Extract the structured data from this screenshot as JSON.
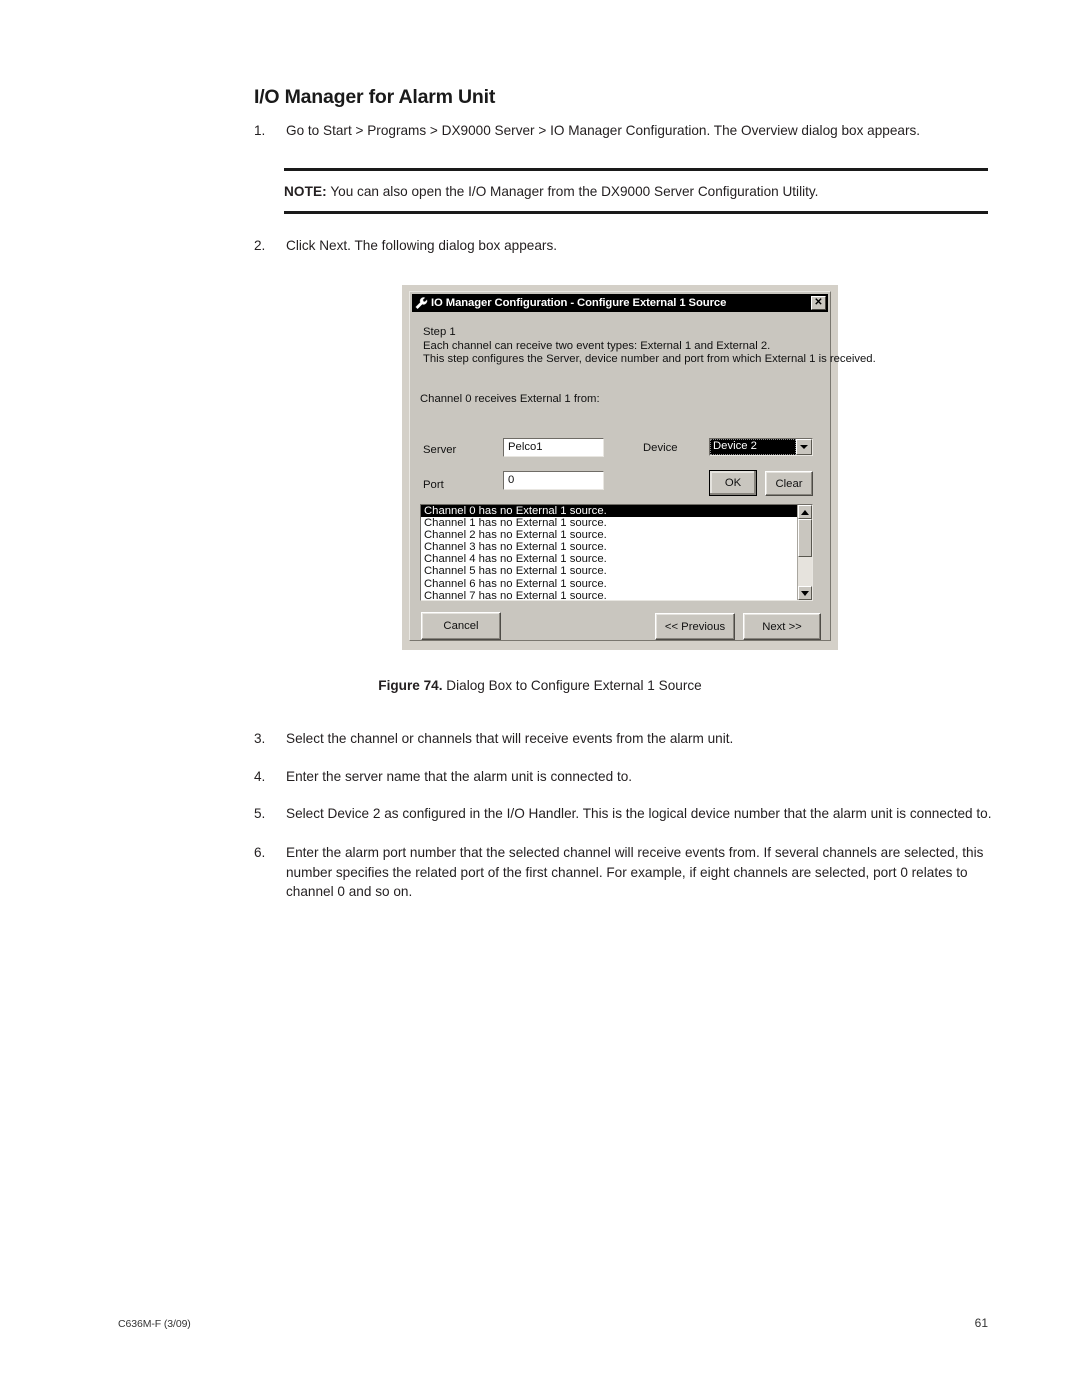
{
  "document": {
    "heading": "I/O Manager for Alarm Unit",
    "steps": [
      {
        "num": "1.",
        "text": "Go to Start > Programs > DX9000 Server > IO Manager Configuration. The Overview dialog box appears."
      },
      {
        "num": "2.",
        "text": "Click Next. The following dialog box appears."
      },
      {
        "num": "3.",
        "text": "Select the channel or channels that will receive events from the alarm unit."
      },
      {
        "num": "4.",
        "text": "Enter the server name that the alarm unit is connected to."
      },
      {
        "num": "5.",
        "text": "Select Device 2 as configured in the I/O Handler. This is the logical device number that the alarm unit is connected to."
      },
      {
        "num": "6.",
        "text": "Enter the alarm port number that the selected channel will receive events from. If several channels are selected, this number specifies the related port of the first channel. For example, if eight channels are selected, port 0 relates to channel 0 and so on."
      }
    ],
    "note": {
      "label": "NOTE:",
      "text": "You can also open the I/O Manager from the DX9000 Server Configuration Utility."
    },
    "figure_caption": {
      "label": "Figure 74.",
      "text": "Dialog Box to Configure External 1 Source"
    },
    "footer": {
      "left": "C636M-F (3/09)",
      "page": "61"
    }
  },
  "dialog": {
    "title": "IO Manager Configuration - Configure External 1 Source",
    "title_icon": "wrench-icon",
    "close_label": "✕",
    "instructions": {
      "line1": "Step 1",
      "line2": "Each channel can receive two event types: External 1 and External 2.",
      "line3": "This step configures the Server, device number and port from which External 1 is received."
    },
    "subprompt": "Channel 0 receives External 1 from:",
    "fields": {
      "server_label": "Server",
      "server_value": "Pelco1",
      "port_label": "Port",
      "port_value": "0",
      "device_label": "Device",
      "device_value": "Device 2"
    },
    "buttons": {
      "ok": "OK",
      "clear": "Clear",
      "cancel": "Cancel",
      "previous": "<< Previous",
      "next": "Next >>"
    },
    "list": {
      "rows": [
        "Channel 0 has no External 1 source.",
        "Channel 1 has no External 1 source.",
        "Channel 2 has no External 1 source.",
        "Channel 3 has no External 1 source.",
        "Channel 4 has no External 1 source.",
        "Channel 5 has no External 1 source.",
        "Channel 6 has no External 1 source.",
        "Channel 7 has no External 1 source."
      ],
      "selected_index": 0
    },
    "colors": {
      "face": "#c9c6bf",
      "titlebar": "#000000",
      "titlebar_text": "#ffffff",
      "selection": "#000000"
    }
  }
}
